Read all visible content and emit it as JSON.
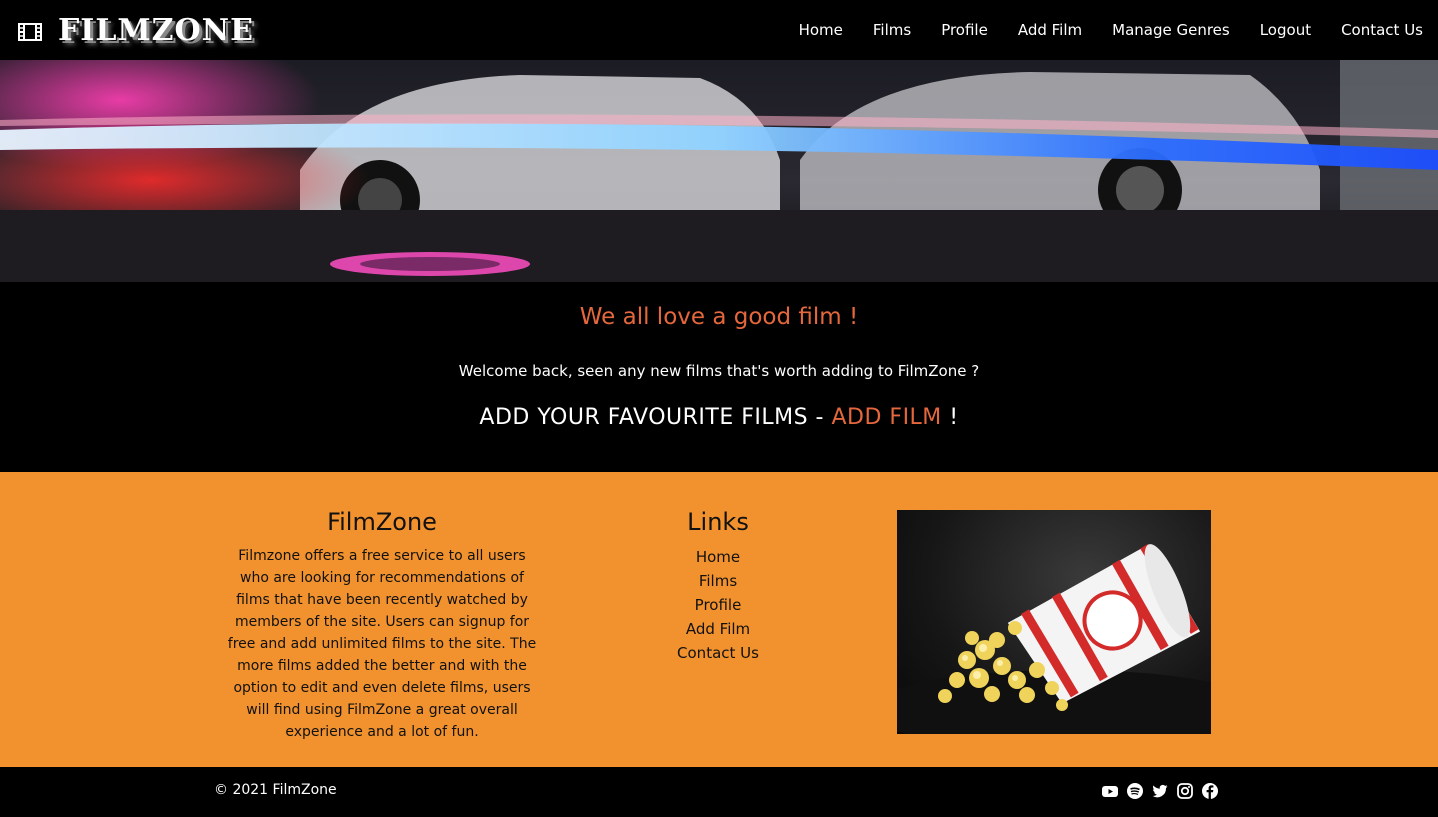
{
  "nav": {
    "brand": "FILMZONE",
    "links": [
      "Home",
      "Films",
      "Profile",
      "Add Film",
      "Manage Genres",
      "Logout",
      "Contact Us"
    ]
  },
  "intro": {
    "heading": "We all love a good film !",
    "text": "Welcome back, seen any new films that's worth adding to FilmZone ?",
    "cta_prefix": "ADD YOUR FAVOURITE FILMS - ",
    "cta_link": "ADD FILM",
    "cta_suffix": " !"
  },
  "footer": {
    "about_title": "FilmZone",
    "about_text": "Filmzone offers a free service to all users who are looking for recommendations of films that have been recently watched by members of the site. Users can signup for free and add unlimited films to the site. The more films added the better and with the option to edit and even delete films, users will find using FilmZone a great overall experience and a lot of fun.",
    "links_title": "Links",
    "links": [
      "Home",
      "Films",
      "Profile",
      "Add Film",
      "Contact Us"
    ]
  },
  "bottom": {
    "copyright": "© 2021 FilmZone",
    "socials": [
      "youtube-icon",
      "spotify-icon",
      "twitter-icon",
      "instagram-icon",
      "facebook-icon"
    ]
  },
  "colors": {
    "accent": "#e5673c",
    "footer_bg": "#f2922e",
    "background": "#000000"
  }
}
